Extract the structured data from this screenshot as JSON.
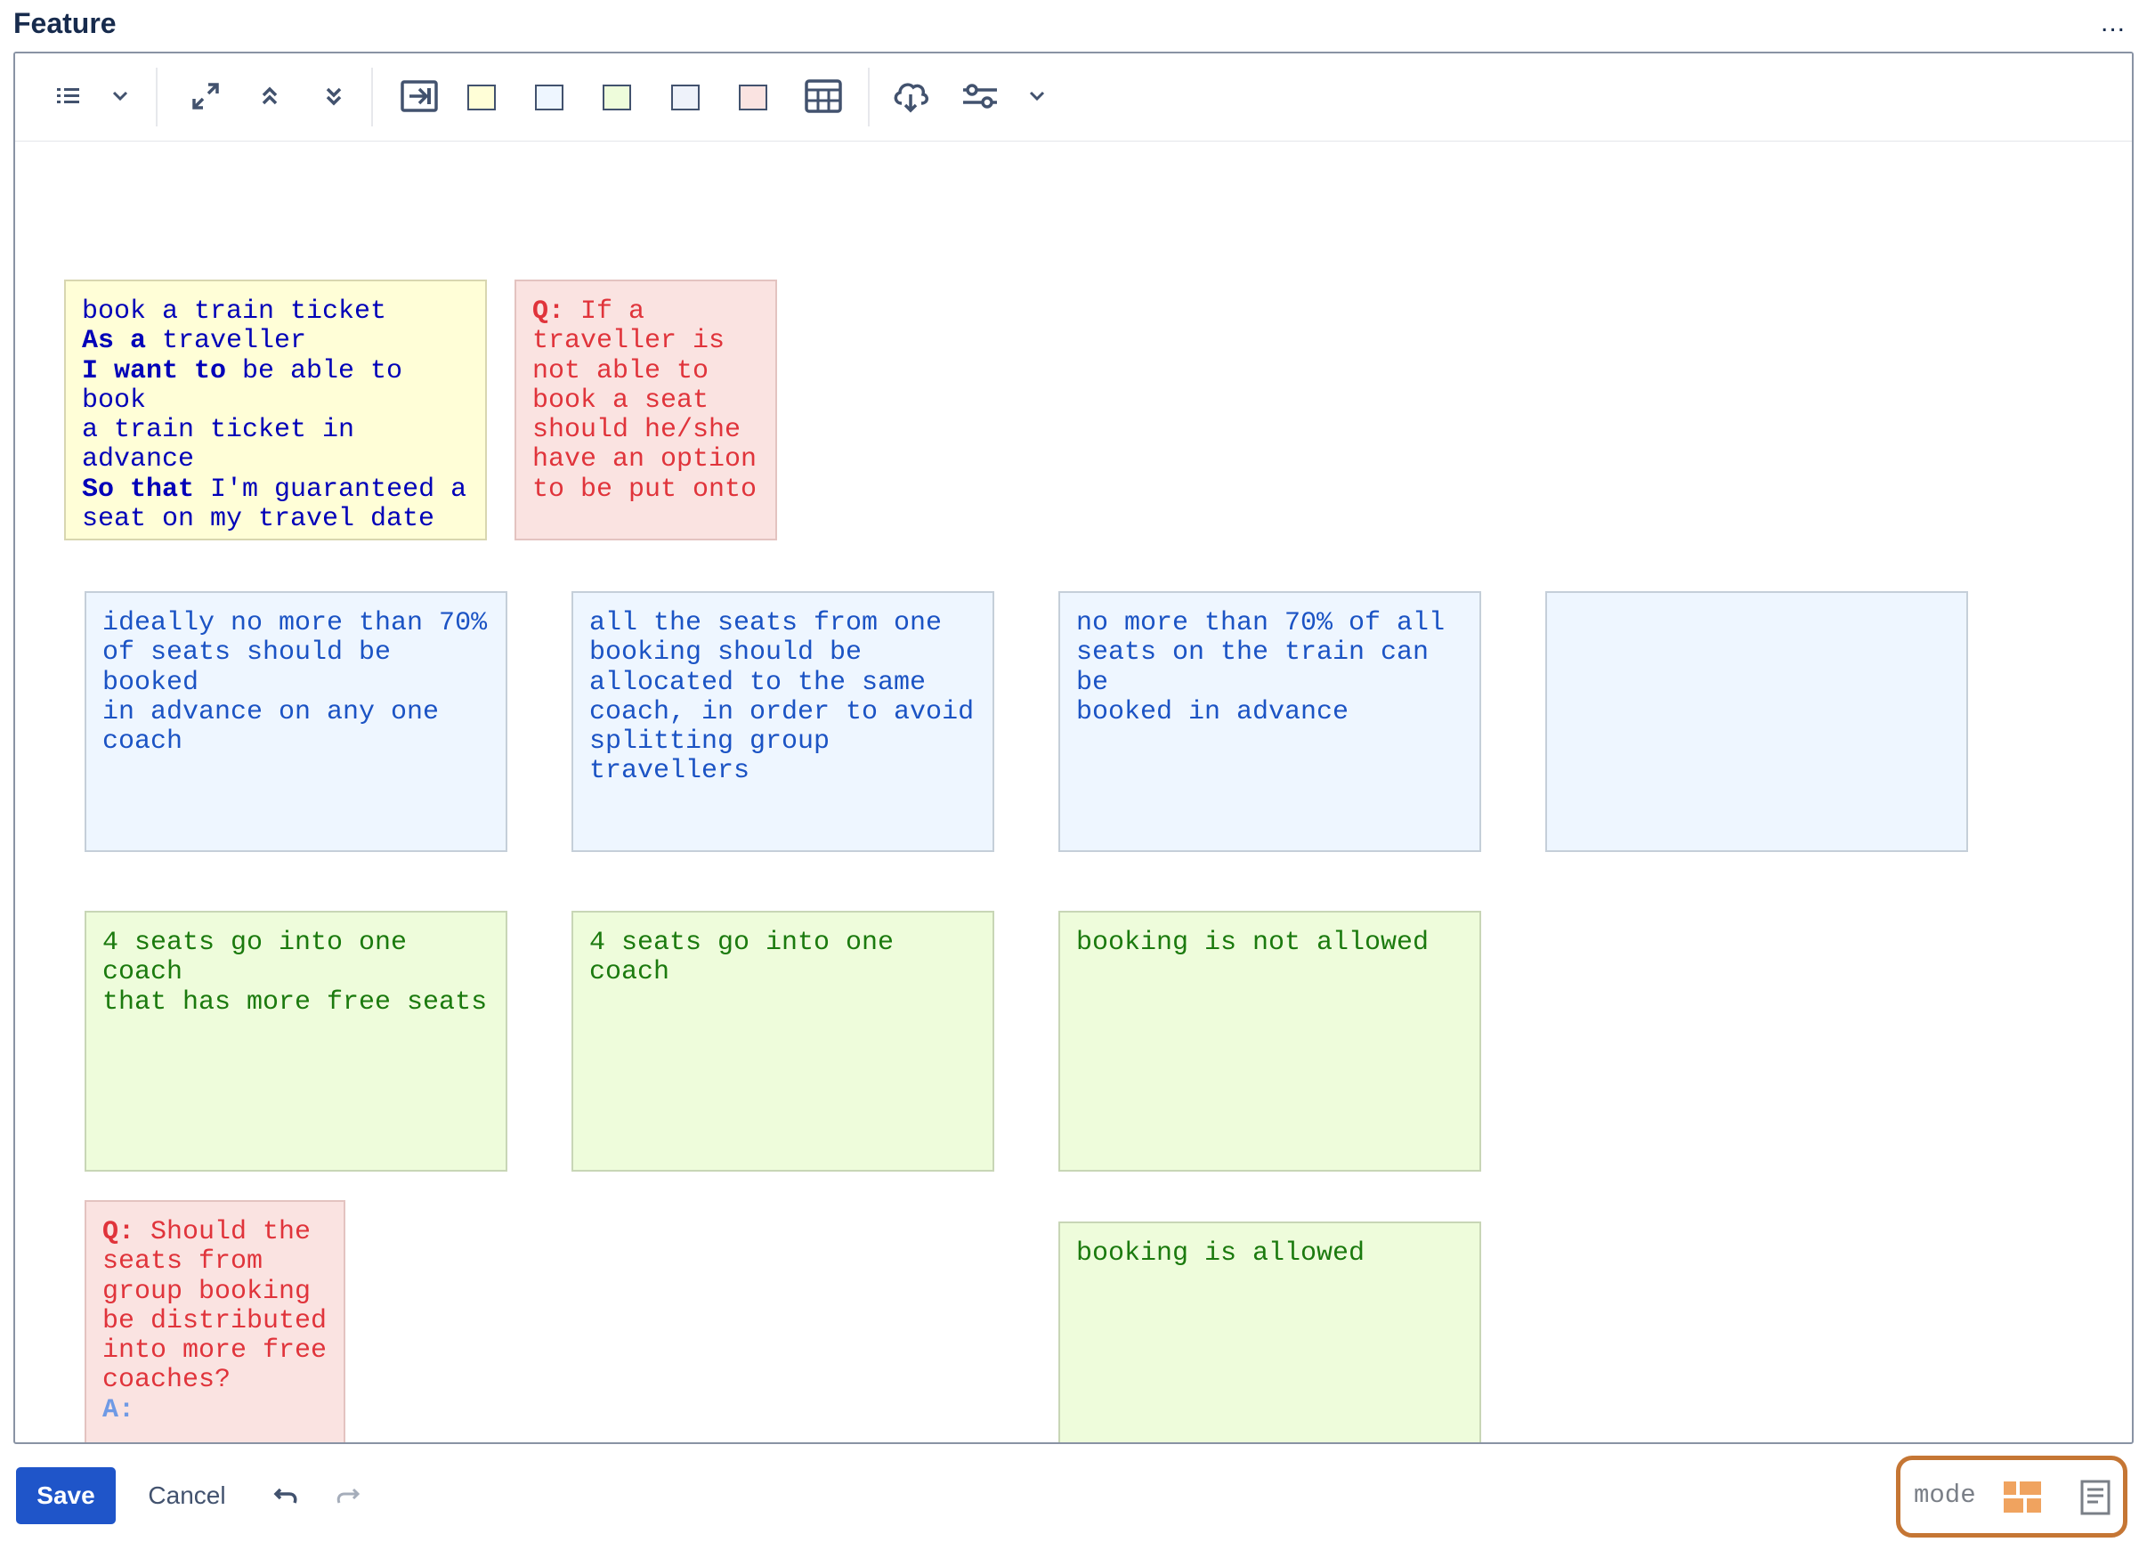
{
  "header": {
    "title": "Feature",
    "more_label": "..."
  },
  "toolbar": {
    "swatch_colors": [
      "#fffed7",
      "#eef6ff",
      "#eefcdb",
      "#eef2fa",
      "#fae3e1"
    ],
    "icons": [
      "list-icon",
      "chevron-down-icon",
      "expand-icon",
      "collapse-up-icon",
      "collapse-down-icon",
      "insert-icon",
      "table-icon",
      "cloud-upload-icon",
      "sliders-icon",
      "chevron-down-icon"
    ]
  },
  "notes": {
    "story": {
      "l1": "book a train ticket",
      "l2_kw": "As a",
      "l2_rest": " traveller",
      "l3_kw": "I want to",
      "l3_rest": " be able to book\na train ticket in advance",
      "l4_kw": "So that",
      "l4_rest": " I'm guaranteed a\nseat on my travel date"
    },
    "question_top": {
      "label": "Q:",
      "text": " If a\ntraveller is\nnot able to\nbook a seat\nshould he/she\nhave an option\nto be put onto"
    },
    "rule1": "ideally no more than 70%\nof seats should be booked\nin advance on any one\ncoach",
    "rule2": "all the seats from one\nbooking should be\nallocated to the same\ncoach, in order to avoid\nsplitting group\ntravellers",
    "rule3": "no more than 70% of all\nseats on the train can be\nbooked in advance",
    "rule4": "",
    "example1": "4 seats go into one coach\nthat has more free seats",
    "example2": "4 seats go into one coach",
    "example3": "booking is not allowed",
    "example4": "booking is allowed",
    "question_bottom": {
      "label": "Q:",
      "text": " Should the\nseats from\ngroup booking\nbe distributed\ninto more free\ncoaches?",
      "answer_label": "A:"
    }
  },
  "footer": {
    "save_label": "Save",
    "cancel_label": "Cancel",
    "mode_label": "mode",
    "mode_accent": "#f0a35f",
    "highlight_color": "#c57634"
  }
}
